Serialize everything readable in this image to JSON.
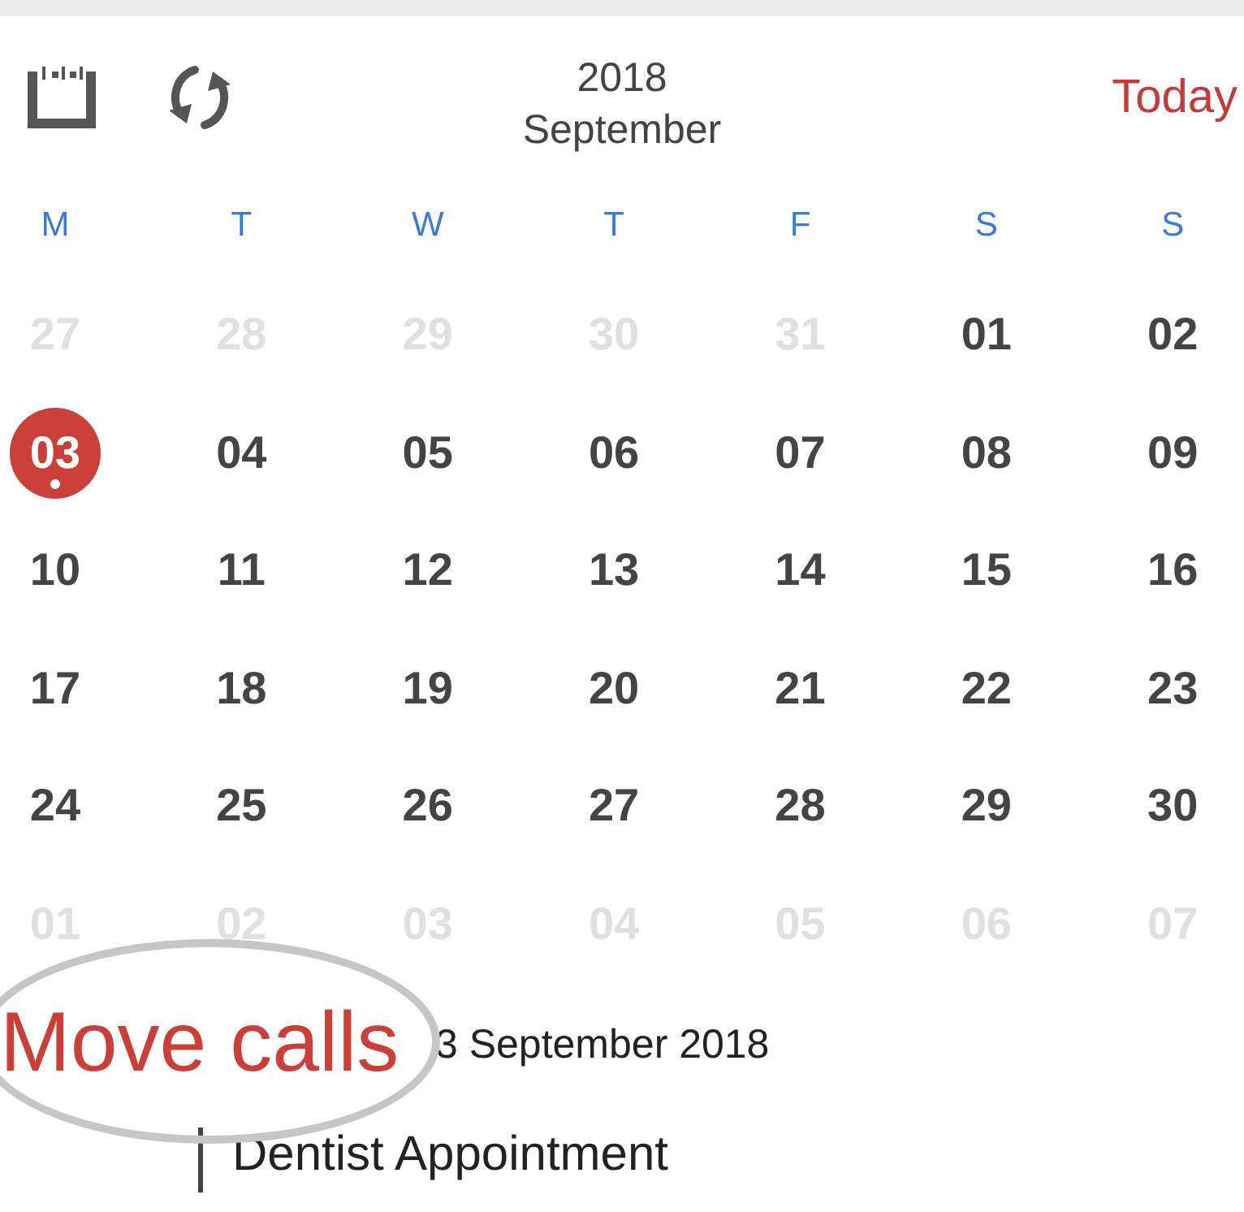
{
  "header": {
    "year": "2018",
    "month": "September",
    "today_button": "Today"
  },
  "weekdays": [
    "M",
    "T",
    "W",
    "T",
    "F",
    "S",
    "S"
  ],
  "weeks": [
    [
      {
        "label": "27",
        "muted": true,
        "selected": false,
        "event_dot": false
      },
      {
        "label": "28",
        "muted": true,
        "selected": false,
        "event_dot": false
      },
      {
        "label": "29",
        "muted": true,
        "selected": false,
        "event_dot": false
      },
      {
        "label": "30",
        "muted": true,
        "selected": false,
        "event_dot": false
      },
      {
        "label": "31",
        "muted": true,
        "selected": false,
        "event_dot": false
      },
      {
        "label": "01",
        "muted": false,
        "selected": false,
        "event_dot": false
      },
      {
        "label": "02",
        "muted": false,
        "selected": false,
        "event_dot": false
      }
    ],
    [
      {
        "label": "03",
        "muted": false,
        "selected": true,
        "event_dot": true
      },
      {
        "label": "04",
        "muted": false,
        "selected": false,
        "event_dot": false
      },
      {
        "label": "05",
        "muted": false,
        "selected": false,
        "event_dot": false
      },
      {
        "label": "06",
        "muted": false,
        "selected": false,
        "event_dot": false
      },
      {
        "label": "07",
        "muted": false,
        "selected": false,
        "event_dot": false
      },
      {
        "label": "08",
        "muted": false,
        "selected": false,
        "event_dot": false
      },
      {
        "label": "09",
        "muted": false,
        "selected": false,
        "event_dot": false
      }
    ],
    [
      {
        "label": "10",
        "muted": false,
        "selected": false,
        "event_dot": false
      },
      {
        "label": "11",
        "muted": false,
        "selected": false,
        "event_dot": false
      },
      {
        "label": "12",
        "muted": false,
        "selected": false,
        "event_dot": false
      },
      {
        "label": "13",
        "muted": false,
        "selected": false,
        "event_dot": false
      },
      {
        "label": "14",
        "muted": false,
        "selected": false,
        "event_dot": false
      },
      {
        "label": "15",
        "muted": false,
        "selected": false,
        "event_dot": false
      },
      {
        "label": "16",
        "muted": false,
        "selected": false,
        "event_dot": false
      }
    ],
    [
      {
        "label": "17",
        "muted": false,
        "selected": false,
        "event_dot": false
      },
      {
        "label": "18",
        "muted": false,
        "selected": false,
        "event_dot": false
      },
      {
        "label": "19",
        "muted": false,
        "selected": false,
        "event_dot": false
      },
      {
        "label": "20",
        "muted": false,
        "selected": false,
        "event_dot": false
      },
      {
        "label": "21",
        "muted": false,
        "selected": false,
        "event_dot": false
      },
      {
        "label": "22",
        "muted": false,
        "selected": false,
        "event_dot": false
      },
      {
        "label": "23",
        "muted": false,
        "selected": false,
        "event_dot": false
      }
    ],
    [
      {
        "label": "24",
        "muted": false,
        "selected": false,
        "event_dot": false
      },
      {
        "label": "25",
        "muted": false,
        "selected": false,
        "event_dot": false
      },
      {
        "label": "26",
        "muted": false,
        "selected": false,
        "event_dot": false
      },
      {
        "label": "27",
        "muted": false,
        "selected": false,
        "event_dot": false
      },
      {
        "label": "28",
        "muted": false,
        "selected": false,
        "event_dot": false
      },
      {
        "label": "29",
        "muted": false,
        "selected": false,
        "event_dot": false
      },
      {
        "label": "30",
        "muted": false,
        "selected": false,
        "event_dot": false
      }
    ],
    [
      {
        "label": "01",
        "muted": true,
        "selected": false,
        "event_dot": false
      },
      {
        "label": "02",
        "muted": true,
        "selected": false,
        "event_dot": false
      },
      {
        "label": "03",
        "muted": true,
        "selected": false,
        "event_dot": false
      },
      {
        "label": "04",
        "muted": true,
        "selected": false,
        "event_dot": false
      },
      {
        "label": "05",
        "muted": true,
        "selected": false,
        "event_dot": false
      },
      {
        "label": "06",
        "muted": true,
        "selected": false,
        "event_dot": false
      },
      {
        "label": "07",
        "muted": true,
        "selected": false,
        "event_dot": false
      }
    ]
  ],
  "day_heading": "3 September 2018",
  "events": [
    {
      "title": "Dentist Appointment"
    }
  ],
  "annotation": {
    "text": "Move calls"
  }
}
